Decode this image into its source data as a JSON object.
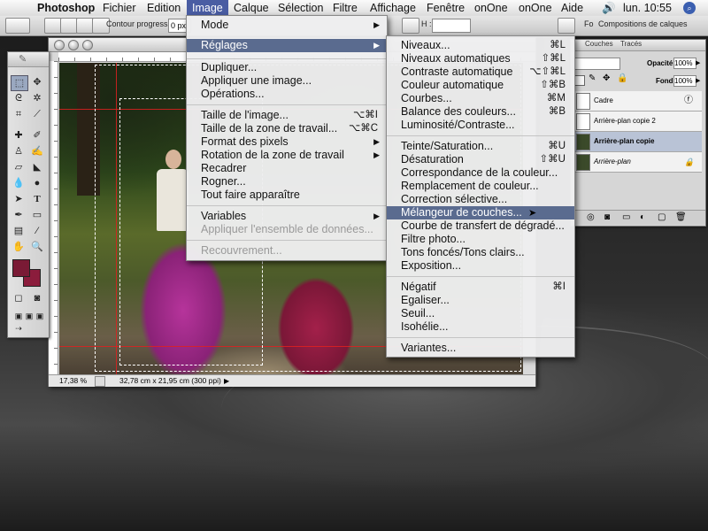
{
  "menubar": {
    "apple": "",
    "items": [
      "Photoshop",
      "Fichier",
      "Edition",
      "Image",
      "Calque",
      "Sélection",
      "Filtre",
      "Affichage",
      "Fenêtre",
      "onOne",
      "onOne",
      "Aide"
    ],
    "active_item": "Image",
    "clock": "lun. 10:55"
  },
  "options_bar": {
    "feather_label": "Contour progressif :",
    "feather_value": "0 px",
    "height_label": "H :",
    "palette_tab_1": "Fo",
    "palette_tab_2": "Compositions de calques"
  },
  "document": {
    "zoom": "17,38 %",
    "size_info": "32,78 cm x 21,95 cm (300 ppi)"
  },
  "layers_palette": {
    "tab_channels": "Couches",
    "tab_paths": "Tracés",
    "opacity_label": "Opacité:",
    "opacity_value": "100%",
    "fill_label": "Fond :",
    "fill_value": "100%",
    "layers": [
      {
        "name": "Cadre",
        "selected": false
      },
      {
        "name": "Arrière-plan copie 2",
        "selected": false
      },
      {
        "name": "Arrière-plan copie",
        "selected": true
      },
      {
        "name": "Arrière-plan",
        "selected": false
      }
    ]
  },
  "image_menu": {
    "items": [
      {
        "label": "Mode",
        "submenu": true
      },
      {
        "label": "Réglages",
        "submenu": true,
        "highlighted": true
      },
      {
        "label": "Dupliquer..."
      },
      {
        "label": "Appliquer une image..."
      },
      {
        "label": "Opérations..."
      },
      {
        "label": "Taille de l'image...",
        "shortcut": "⌥⌘I"
      },
      {
        "label": "Taille de la zone de travail...",
        "shortcut": "⌥⌘C"
      },
      {
        "label": "Format des pixels",
        "submenu": true
      },
      {
        "label": "Rotation de la zone de travail",
        "submenu": true
      },
      {
        "label": "Recadrer"
      },
      {
        "label": "Rogner..."
      },
      {
        "label": "Tout faire apparaître"
      },
      {
        "label": "Variables",
        "submenu": true
      },
      {
        "label": "Appliquer l'ensemble de données...",
        "disabled": true
      },
      {
        "label": "Recouvrement...",
        "disabled": true
      }
    ]
  },
  "adjustments_menu": {
    "items": [
      {
        "label": "Niveaux...",
        "shortcut": "⌘L"
      },
      {
        "label": "Niveaux automatiques",
        "shortcut": "⇧⌘L"
      },
      {
        "label": "Contraste automatique",
        "shortcut": "⌥⇧⌘L"
      },
      {
        "label": "Couleur automatique",
        "shortcut": "⇧⌘B"
      },
      {
        "label": "Courbes...",
        "shortcut": "⌘M"
      },
      {
        "label": "Balance des couleurs...",
        "shortcut": "⌘B"
      },
      {
        "label": "Luminosité/Contraste..."
      },
      {
        "label": "Teinte/Saturation...",
        "shortcut": "⌘U"
      },
      {
        "label": "Désaturation",
        "shortcut": "⇧⌘U"
      },
      {
        "label": "Correspondance de la couleur..."
      },
      {
        "label": "Remplacement de couleur..."
      },
      {
        "label": "Correction sélective..."
      },
      {
        "label": "Mélangeur de couches...",
        "highlighted": true
      },
      {
        "label": "Courbe de transfert de dégradé..."
      },
      {
        "label": "Filtre photo..."
      },
      {
        "label": "Tons foncés/Tons clairs..."
      },
      {
        "label": "Exposition..."
      },
      {
        "label": "Négatif",
        "shortcut": "⌘I"
      },
      {
        "label": "Egaliser..."
      },
      {
        "label": "Seuil..."
      },
      {
        "label": "Isohélie..."
      },
      {
        "label": "Variantes..."
      }
    ]
  },
  "colors": {
    "menubar_highlight": "#4a5da3",
    "menu_highlight": "#5a6b8f",
    "foreground_swatch": "#7a1a35",
    "background_swatch": "#8b1c3c"
  }
}
